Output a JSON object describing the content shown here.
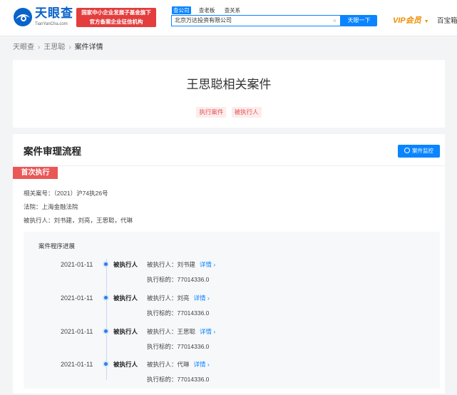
{
  "header": {
    "logo_text": "天眼查",
    "logo_sub": "TianYanCha.com",
    "banner_line1": "国家中小企业发展子基金旗下",
    "banner_line2": "官方备案企业征信机构",
    "search_tabs": [
      "查公司",
      "查老板",
      "查关系"
    ],
    "search_value": "北京万达投资有限公司",
    "search_clear": "×",
    "search_button": "天眼一下",
    "vip_label": "VIP会员",
    "vip_arrow": "▼",
    "baibao": "百宝箱"
  },
  "breadcrumb": {
    "items": [
      "天眼查",
      "王思聪"
    ],
    "current": "案件详情",
    "separator": "›"
  },
  "title_card": {
    "title": "王思聪相关案件",
    "tags": [
      "执行案件",
      "被执行人"
    ]
  },
  "process": {
    "section_title": "案件审理流程",
    "monitor_button": "案件监控",
    "badge": "首次执行",
    "case_no": "相关案号：（2021）沪74执26号",
    "court": "法院：上海金融法院",
    "executed": "被执行人：刘书建，刘亮，王思聪，代琳",
    "timeline_title": "案件程序进展",
    "items": [
      {
        "date": "2021-01-11",
        "label": "被执行人",
        "person": "被执行人：刘书建",
        "detail": "详情 ›",
        "target": "执行标的：77014336.0"
      },
      {
        "date": "2021-01-11",
        "label": "被执行人",
        "person": "被执行人：刘亮",
        "detail": "详情 ›",
        "target": "执行标的：77014336.0"
      },
      {
        "date": "2021-01-11",
        "label": "被执行人",
        "person": "被执行人：王思聪",
        "detail": "详情 ›",
        "target": "执行标的：77014336.0"
      },
      {
        "date": "2021-01-11",
        "label": "被执行人",
        "person": "被执行人：代琳",
        "detail": "详情 ›",
        "target": "执行标的：77014336.0"
      }
    ]
  },
  "colors": {
    "brand_blue": "#0a84ff",
    "badge_red": "#ea5757",
    "vip_orange": "#f08c00"
  }
}
